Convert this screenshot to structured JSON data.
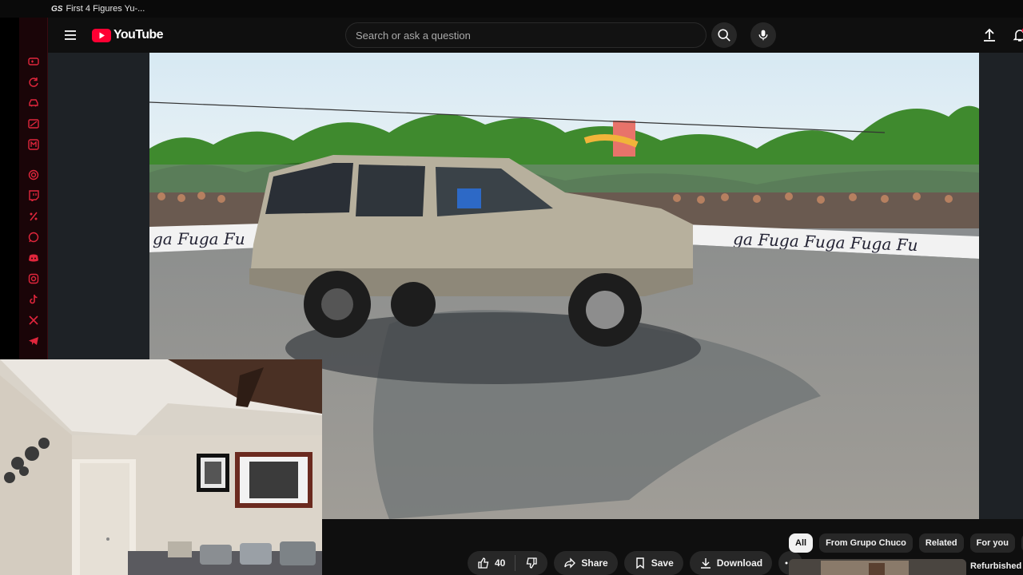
{
  "browser": {
    "tab_favicon": "GS",
    "tab_title": "First 4 Figures Yu-..."
  },
  "sidebar_icons": [
    "gamepad-icon",
    "refresh-icon",
    "car-icon",
    "card-icon",
    "m-box-icon",
    "spiral-icon",
    "twitch-icon",
    "percent-icon",
    "whatsapp-icon",
    "discord-icon",
    "instagram-icon",
    "tiktok-icon",
    "x-icon",
    "telegram-icon"
  ],
  "header": {
    "logo_text": "YouTube",
    "search_placeholder": "Search or ask a question"
  },
  "video": {
    "banner_text": "Fuga Fuga Fuga Fuga Fuga Fuga Fuga Fu"
  },
  "actions": {
    "like_count": "40",
    "share_label": "Share",
    "save_label": "Save",
    "download_label": "Download"
  },
  "chips": [
    "All",
    "From Grupo Chuco",
    "Related",
    "For you",
    "R"
  ],
  "recommendation": {
    "title": "Refurbished B"
  },
  "colors": {
    "accent": "#ff0033",
    "sidebar_icon": "#e0263c"
  }
}
